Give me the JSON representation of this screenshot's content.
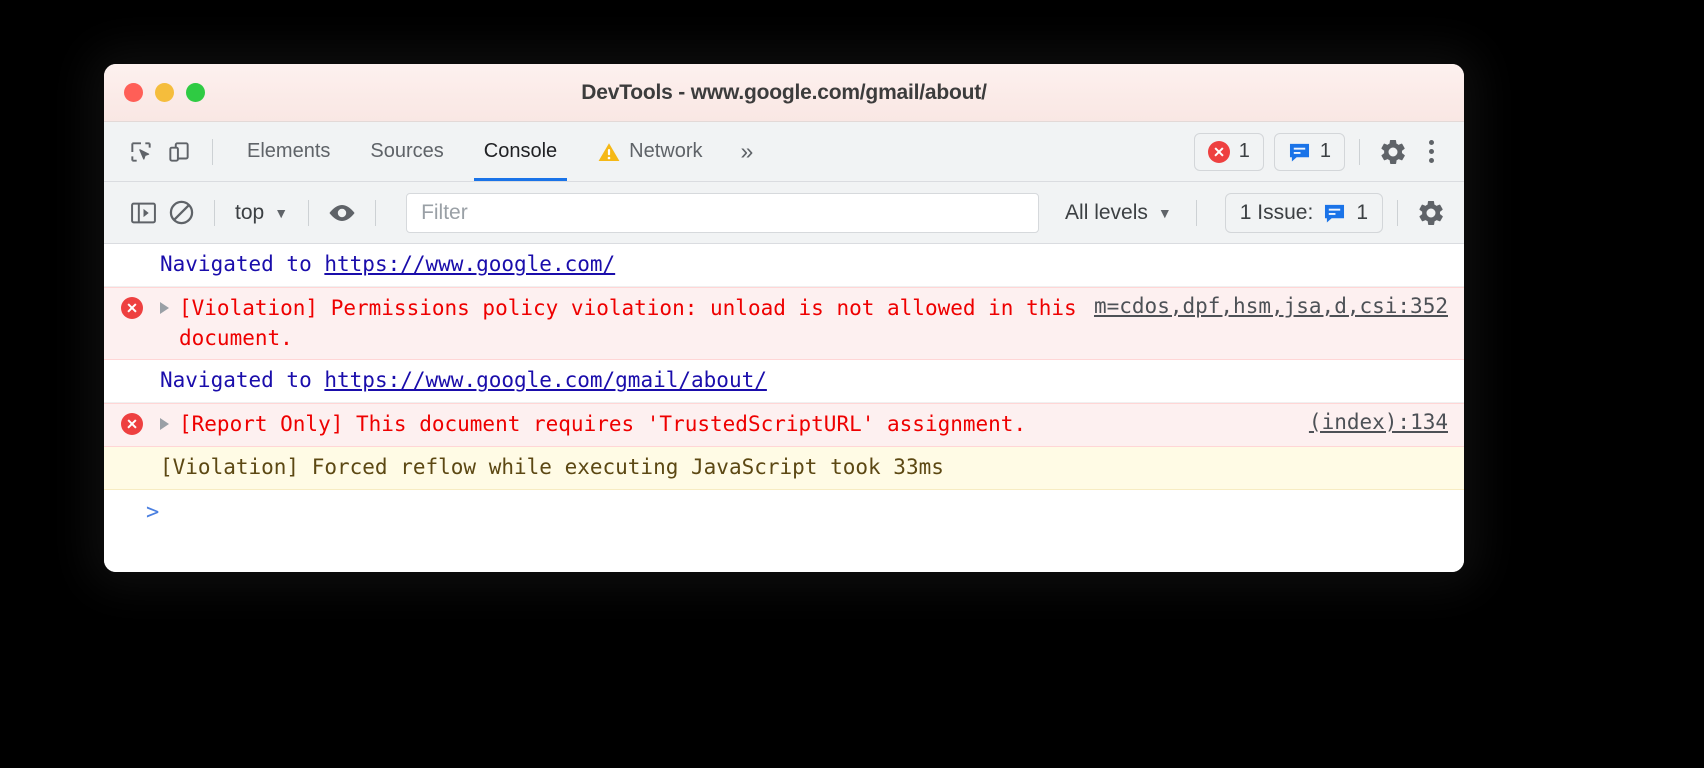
{
  "window": {
    "title": "DevTools - www.google.com/gmail/about/",
    "traffic_lights": [
      "close-red",
      "minimize-yellow",
      "maximize-green"
    ]
  },
  "tabbar": {
    "inspect_icon": "inspect-element-icon",
    "device_icon": "device-toolbar-icon",
    "tabs": [
      {
        "label": "Elements",
        "active": false,
        "icon": null
      },
      {
        "label": "Sources",
        "active": false,
        "icon": null
      },
      {
        "label": "Console",
        "active": true,
        "icon": null
      },
      {
        "label": "Network",
        "active": false,
        "icon": "warning-triangle-icon"
      }
    ],
    "overflow_label": "»",
    "error_badge": {
      "icon": "error-circle-icon",
      "count": "1"
    },
    "issues_badge": {
      "icon": "issues-message-icon",
      "count": "1"
    },
    "settings_icon": "gear-icon",
    "more_icon": "kebab-menu-icon"
  },
  "filterbar": {
    "sidebar_toggle_icon": "console-sidebar-icon",
    "clear_icon": "clear-console-icon",
    "context_label": "top",
    "context_caret": "▼",
    "eye_icon": "live-expression-eye-icon",
    "filter_placeholder": "Filter",
    "filter_value": "",
    "levels_label": "All levels",
    "levels_caret": "▼",
    "issues_label": "1 Issue:",
    "issues_icon": "issues-message-icon",
    "issues_count": "1",
    "settings_icon": "gear-icon"
  },
  "console": {
    "rows": [
      {
        "kind": "info",
        "icon": null,
        "expandable": false,
        "text_prefix": "Navigated to ",
        "link_text": "https://www.google.com/",
        "source": ""
      },
      {
        "kind": "error",
        "icon": "error-circle-icon",
        "expandable": true,
        "text_prefix": "[Violation] Permissions policy violation: unload is not allowed in this document.",
        "link_text": "",
        "source": "m=cdos,dpf,hsm,jsa,d,csi:352"
      },
      {
        "kind": "info",
        "icon": null,
        "expandable": false,
        "text_prefix": "Navigated to ",
        "link_text": "https://www.google.com/gmail/about/",
        "source": ""
      },
      {
        "kind": "error",
        "icon": "error-circle-icon",
        "expandable": true,
        "text_prefix": "[Report Only] This document requires 'TrustedScriptURL' assignment.",
        "link_text": "",
        "source": "(index):134"
      },
      {
        "kind": "warn",
        "icon": null,
        "expandable": false,
        "text_prefix": "[Violation] Forced reflow while executing JavaScript took 33ms",
        "link_text": "",
        "source": ""
      }
    ],
    "prompt": ">"
  },
  "colors": {
    "accent_blue": "#1a73e8",
    "error_red": "#ee0000",
    "error_bg": "#fdf0f0",
    "warn_bg": "#fffbe5",
    "link_blue": "#1a0dab",
    "toolbar_bg": "#f1f3f4",
    "titlebar_bg": "#fbebe8"
  }
}
